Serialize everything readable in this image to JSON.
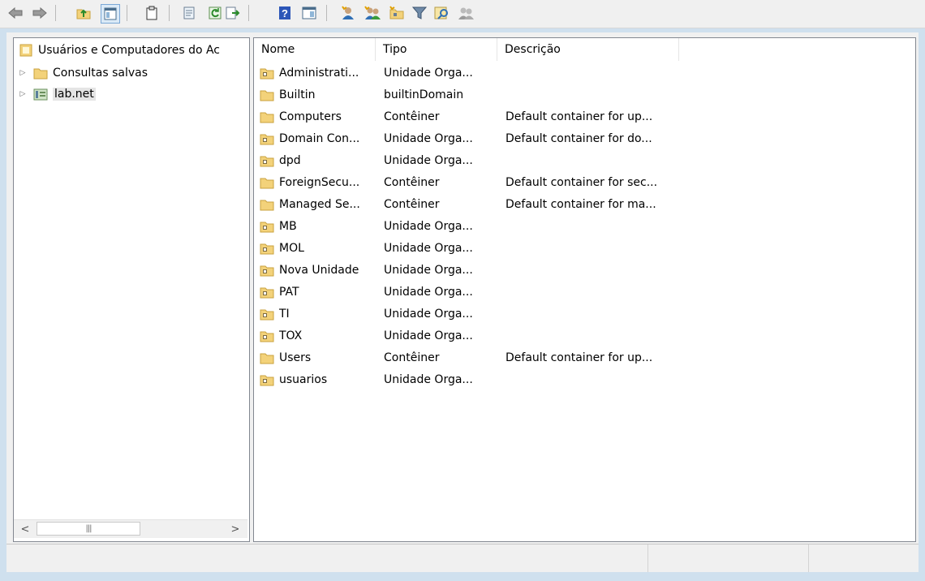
{
  "toolbar": {
    "buttons": [
      {
        "name": "back-arrow-icon"
      },
      {
        "name": "forward-arrow-icon"
      },
      {
        "name": "up-folder-icon"
      },
      {
        "name": "show-hide-console-tree-icon"
      },
      {
        "name": "clipboard-icon"
      },
      {
        "name": "properties-icon"
      },
      {
        "name": "refresh-icon"
      },
      {
        "name": "export-list-icon"
      },
      {
        "name": "help-icon"
      },
      {
        "name": "show-action-pane-icon"
      },
      {
        "name": "new-user-icon"
      },
      {
        "name": "new-group-icon"
      },
      {
        "name": "new-ou-icon"
      },
      {
        "name": "filter-icon"
      },
      {
        "name": "find-icon"
      },
      {
        "name": "add-to-group-icon"
      }
    ]
  },
  "tree": {
    "root_label": "Usuários e Computadores do Ac",
    "items": [
      {
        "label": "Consultas salvas",
        "icon": "folder-icon"
      },
      {
        "label": "lab.net",
        "icon": "domain-icon"
      }
    ]
  },
  "list": {
    "columns": [
      "Nome",
      "Tipo",
      "Descrição"
    ],
    "rows": [
      {
        "name": "Administrati...",
        "type": "Unidade Orga...",
        "desc": "",
        "icon": "ou"
      },
      {
        "name": "Builtin",
        "type": "builtinDomain",
        "desc": "",
        "icon": "folder"
      },
      {
        "name": "Computers",
        "type": "Contêiner",
        "desc": "Default container for up...",
        "icon": "folder"
      },
      {
        "name": "Domain Con...",
        "type": "Unidade Orga...",
        "desc": "Default container for do...",
        "icon": "ou"
      },
      {
        "name": "dpd",
        "type": "Unidade Orga...",
        "desc": "",
        "icon": "ou"
      },
      {
        "name": "ForeignSecu...",
        "type": "Contêiner",
        "desc": "Default container for sec...",
        "icon": "folder"
      },
      {
        "name": "Managed Se...",
        "type": "Contêiner",
        "desc": "Default container for ma...",
        "icon": "folder"
      },
      {
        "name": "MB",
        "type": "Unidade Orga...",
        "desc": "",
        "icon": "ou"
      },
      {
        "name": "MOL",
        "type": "Unidade Orga...",
        "desc": "",
        "icon": "ou"
      },
      {
        "name": "Nova Unidade",
        "type": "Unidade Orga...",
        "desc": "",
        "icon": "ou"
      },
      {
        "name": "PAT",
        "type": "Unidade Orga...",
        "desc": "",
        "icon": "ou"
      },
      {
        "name": "TI",
        "type": "Unidade Orga...",
        "desc": "",
        "icon": "ou"
      },
      {
        "name": "TOX",
        "type": "Unidade Orga...",
        "desc": "",
        "icon": "ou"
      },
      {
        "name": "Users",
        "type": "Contêiner",
        "desc": "Default container for up...",
        "icon": "folder"
      },
      {
        "name": "usuarios",
        "type": "Unidade Orga...",
        "desc": "",
        "icon": "ou"
      }
    ]
  },
  "colors": {
    "background": "#cfe0ee",
    "chrome": "#f0f0f0",
    "folder": "#f3d27a",
    "border": "#828790"
  }
}
